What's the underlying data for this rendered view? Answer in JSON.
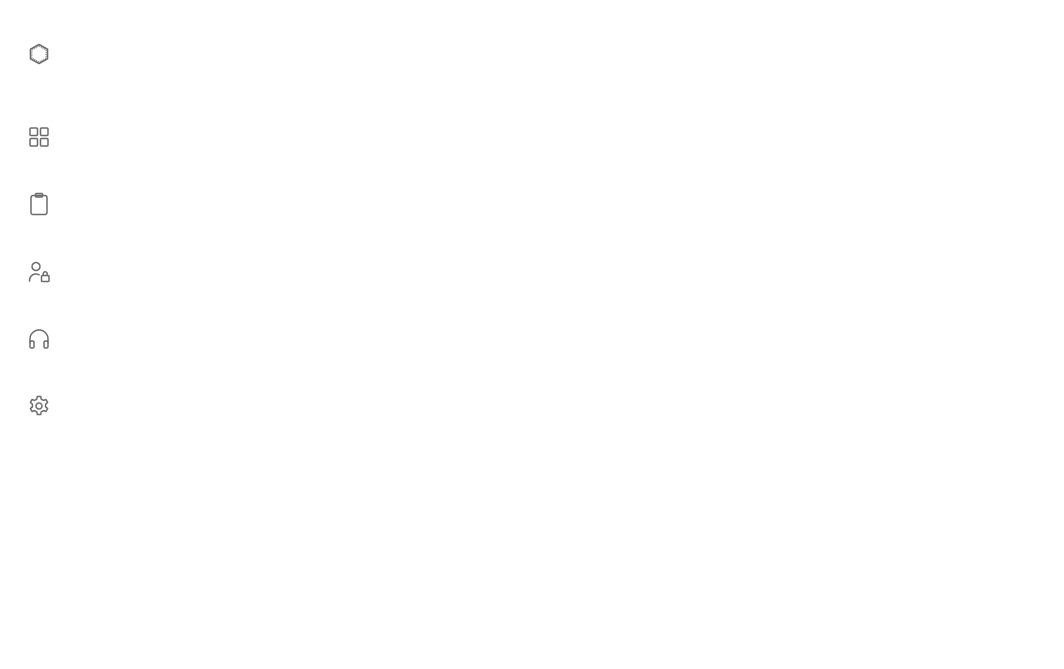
{
  "sidebar": {
    "logo": {
      "icon": "hexagon-logo-icon"
    },
    "items": [
      {
        "id": "dashboard",
        "icon": "grid-icon"
      },
      {
        "id": "clipboard",
        "icon": "clipboard-icon"
      },
      {
        "id": "user-lock",
        "icon": "user-lock-icon"
      },
      {
        "id": "support",
        "icon": "headphones-icon"
      },
      {
        "id": "settings",
        "icon": "gear-icon"
      }
    ]
  },
  "colors": {
    "icon_stroke": "#6b6b6b",
    "background": "#ffffff"
  }
}
